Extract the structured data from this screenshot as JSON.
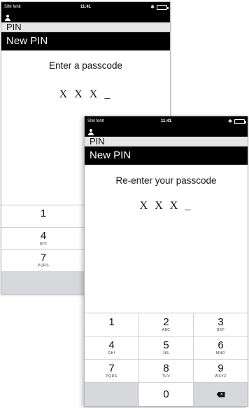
{
  "back_screen": {
    "status": {
      "carrier": "SIM fehlt",
      "time": "11:41",
      "bluetooth": "✱"
    },
    "section": "PIN",
    "title": "New PIN",
    "prompt": "Enter a passcode",
    "entry": "X X X _",
    "keys": [
      {
        "num": "1",
        "letters": ""
      },
      {
        "num": "",
        "letters": ""
      },
      {
        "num": "4",
        "letters": "GHI"
      },
      {
        "num": "",
        "letters": ""
      },
      {
        "num": "7",
        "letters": "PQRS"
      },
      {
        "num": "",
        "letters": ""
      },
      {
        "num": "",
        "letters": ""
      },
      {
        "num": "",
        "letters": ""
      }
    ]
  },
  "front_screen": {
    "status": {
      "carrier": "SIM fehlt",
      "time": "11:41",
      "bluetooth": "✱"
    },
    "section": "PIN",
    "title": "New PIN",
    "prompt": "Re-enter your passcode",
    "entry": "X X X _",
    "keys": [
      {
        "num": "1",
        "letters": ""
      },
      {
        "num": "2",
        "letters": "ABC"
      },
      {
        "num": "3",
        "letters": "DEF"
      },
      {
        "num": "4",
        "letters": "GHI"
      },
      {
        "num": "5",
        "letters": "JKL"
      },
      {
        "num": "6",
        "letters": "MNO"
      },
      {
        "num": "7",
        "letters": "PQRS"
      },
      {
        "num": "8",
        "letters": "TUV"
      },
      {
        "num": "9",
        "letters": "WXYZ"
      },
      {
        "num": "0",
        "letters": ""
      }
    ]
  },
  "icons": {
    "user": "user-icon",
    "backspace": "backspace-icon",
    "battery": "battery-icon"
  },
  "colors": {
    "bar": "#000000",
    "battery_fill": "#3ecf3e",
    "blank_key": "#d6d8dc"
  }
}
